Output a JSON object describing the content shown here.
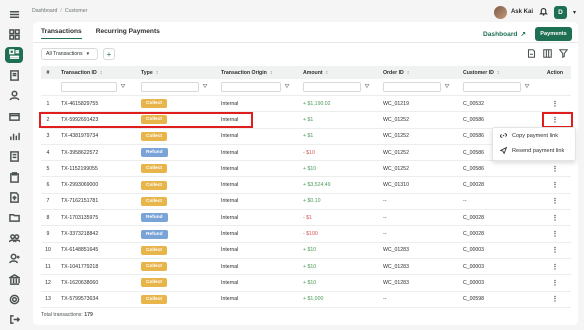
{
  "breadcrumb": {
    "root": "Dashboard",
    "separator": "/",
    "current": "Customer"
  },
  "user": {
    "name": "Ask Kai",
    "initial": "D"
  },
  "tabs": [
    {
      "label": "Transactions"
    },
    {
      "label": "Recurring Payments"
    }
  ],
  "actions": {
    "dashboard_link": "Dashboard",
    "payments_button": "Payments"
  },
  "filter": {
    "selected": "All Transactions",
    "add": "+"
  },
  "table": {
    "headers": [
      "#",
      "Transaction ID",
      "Type",
      "Transaction Origin",
      "Amount",
      "Order ID",
      "Customer ID",
      "Action"
    ],
    "rows": [
      {
        "n": "1",
        "id": "TX-4615829755",
        "type": "Collect",
        "origin": "Internal",
        "amount": "+ $1,190.02",
        "order": "WC_01219",
        "customer": "C_00532"
      },
      {
        "n": "2",
        "id": "TX-5992691423",
        "type": "Collect",
        "origin": "Internal",
        "amount": "+ $1",
        "order": "WC_01252",
        "customer": "C_00586"
      },
      {
        "n": "3",
        "id": "TX-4381979734",
        "type": "Collect",
        "origin": "Internal",
        "amount": "+ $1",
        "order": "WC_01252",
        "customer": "C_00586"
      },
      {
        "n": "4",
        "id": "TX-3958622572",
        "type": "Refund",
        "origin": "Internal",
        "amount": "- $10",
        "order": "WC_01252",
        "customer": "C_00586"
      },
      {
        "n": "5",
        "id": "TX-1152199055",
        "type": "Collect",
        "origin": "Internal",
        "amount": "+ $10",
        "order": "WC_01252",
        "customer": "C_00586"
      },
      {
        "n": "6",
        "id": "TX-2993069000",
        "type": "Collect",
        "origin": "Internal",
        "amount": "+ $3,524.49",
        "order": "WC_01310",
        "customer": "C_00028"
      },
      {
        "n": "7",
        "id": "TX-7162151781",
        "type": "Collect",
        "origin": "Internal",
        "amount": "+ $0.10",
        "order": "--",
        "customer": "--"
      },
      {
        "n": "8",
        "id": "TX-1703135975",
        "type": "Refund",
        "origin": "Internal",
        "amount": "- $1",
        "order": "--",
        "customer": "C_00028"
      },
      {
        "n": "9",
        "id": "TX-3373218842",
        "type": "Refund",
        "origin": "Internal",
        "amount": "- $100",
        "order": "--",
        "customer": "C_00028"
      },
      {
        "n": "10",
        "id": "TX-6148851645",
        "type": "Collect",
        "origin": "Internal",
        "amount": "+ $10",
        "order": "WC_01283",
        "customer": "C_00003"
      },
      {
        "n": "11",
        "id": "TX-1041779218",
        "type": "Collect",
        "origin": "Internal",
        "amount": "+ $10",
        "order": "WC_01283",
        "customer": "C_00003"
      },
      {
        "n": "12",
        "id": "TX-1620638060",
        "type": "Collect",
        "origin": "Internal",
        "amount": "+ $10",
        "order": "WC_01283",
        "customer": "C_00003"
      },
      {
        "n": "13",
        "id": "TX-5799573634",
        "type": "Collect",
        "origin": "Internal",
        "amount": "+ $1,000",
        "order": "--",
        "customer": "C_00598"
      }
    ]
  },
  "footer": {
    "label": "Total transactions:",
    "count": "179"
  },
  "context_menu": {
    "items": [
      {
        "label": "Copy payment link"
      },
      {
        "label": "Resend payment link"
      }
    ]
  },
  "colors": {
    "brand": "#1f6f52",
    "collect": "#e7b54a",
    "refund": "#7aa3d8",
    "highlight": "#e01e1e"
  }
}
